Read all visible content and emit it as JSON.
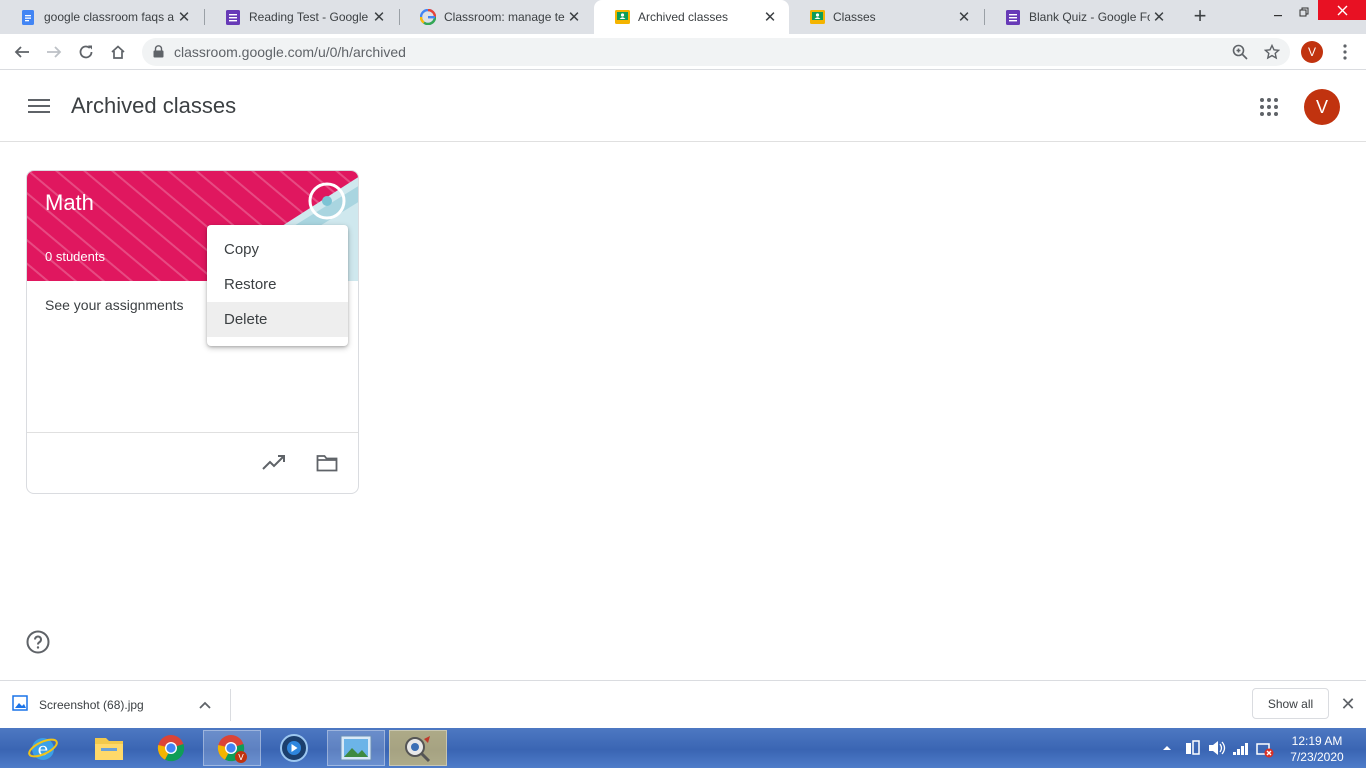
{
  "browser": {
    "tabs": [
      {
        "title": "google classroom faqs a",
        "icon": "google-docs-icon",
        "active": false
      },
      {
        "title": "Reading Test - Google Fo",
        "icon": "google-forms-icon",
        "active": false
      },
      {
        "title": "Classroom: manage teac",
        "icon": "google-g-icon",
        "active": false
      },
      {
        "title": "Archived classes",
        "icon": "google-classroom-icon",
        "active": true
      },
      {
        "title": "Classes",
        "icon": "google-classroom-icon",
        "active": false
      },
      {
        "title": "Blank Quiz - Google For",
        "icon": "google-forms-icon",
        "active": false
      }
    ],
    "close_glyph": "✕",
    "new_tab_glyph": "+",
    "url": "classroom.google.com/u/0/h/archived",
    "profile_initial": "V"
  },
  "app": {
    "title": "Archived classes",
    "avatar_initial": "V",
    "accent": "#e0175f",
    "avatar_color": "#c1330f"
  },
  "class_card": {
    "name": "Math",
    "students": "0 students",
    "description": "See your assignments"
  },
  "context_menu": {
    "items": [
      {
        "label": "Copy"
      },
      {
        "label": "Restore"
      },
      {
        "label": "Delete"
      }
    ],
    "hovered": "Delete"
  },
  "downloads": {
    "file_name": "Screenshot (68).jpg",
    "show_all": "Show all"
  },
  "taskbar": {
    "time": "12:19 AM",
    "date": "7/23/2020"
  }
}
